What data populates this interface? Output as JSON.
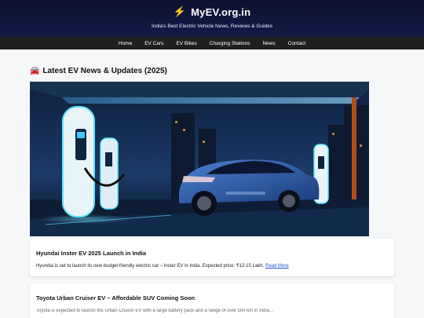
{
  "header": {
    "bolt_icon": "lightning-bolt-icon",
    "title": "MyEV.org.in",
    "tagline": "India's Best Electric Vehicle News, Reviews & Guides"
  },
  "nav": {
    "items": [
      "Home",
      "EV Cars",
      "EV Bikes",
      "Charging Stations",
      "News",
      "Contact"
    ]
  },
  "main": {
    "section_icon": "car-icon",
    "section_title": "Latest EV News & Updates (2025)",
    "articles": [
      {
        "title": "Hyundai Inster EV 2025 Launch in India",
        "text": "Hyundai is set to launch its new budget-friendly electric car – Inster EV in India. Expected price: ₹12-15 Lakh.",
        "link": "Read More"
      },
      {
        "title": "Toyota Urban Cruiser EV – Affordable SUV Coming Soon",
        "text": "Toyota is expected to launch the Urban Cruiser EV with a large battery pack and a range of over 500 km in India..."
      }
    ]
  },
  "colors": {
    "header_bg": "#0c1130",
    "nav_bg": "#1f1f1f",
    "accent": "#ffcc2e",
    "link": "#1e4fd8"
  }
}
